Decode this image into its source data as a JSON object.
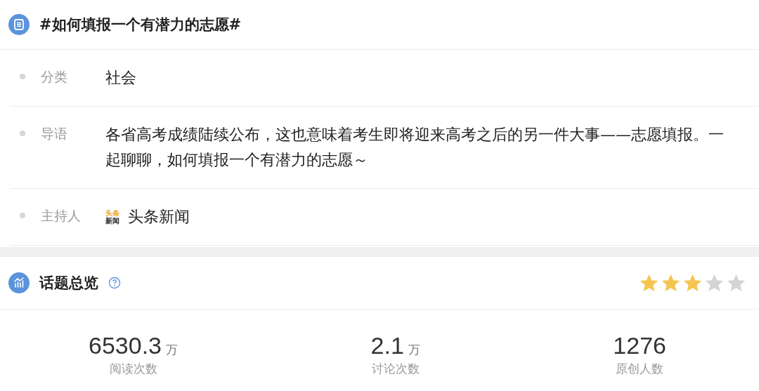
{
  "topic": {
    "title": "#如何填报一个有潜力的志愿#",
    "fields": [
      {
        "kind": "text",
        "label": "分类",
        "value": "社会"
      },
      {
        "kind": "text",
        "label": "导语",
        "value": "各省高考成绩陆续公布，这也意味着考生即将迎来高考之后的另一件大事——志愿填报。一起聊聊，如何填报一个有潜力的志愿～"
      },
      {
        "kind": "host",
        "label": "主持人",
        "logo_lines": [
          "头条",
          "新闻"
        ],
        "value": "头条新闻"
      }
    ]
  },
  "overview": {
    "title": "话题总览",
    "stars": 3,
    "stats": [
      {
        "value": "6530.3",
        "unit": "万",
        "label": "阅读次数"
      },
      {
        "value": "2.1",
        "unit": "万",
        "label": "讨论次数"
      },
      {
        "value": "1276",
        "label": "原创人数"
      }
    ]
  }
}
